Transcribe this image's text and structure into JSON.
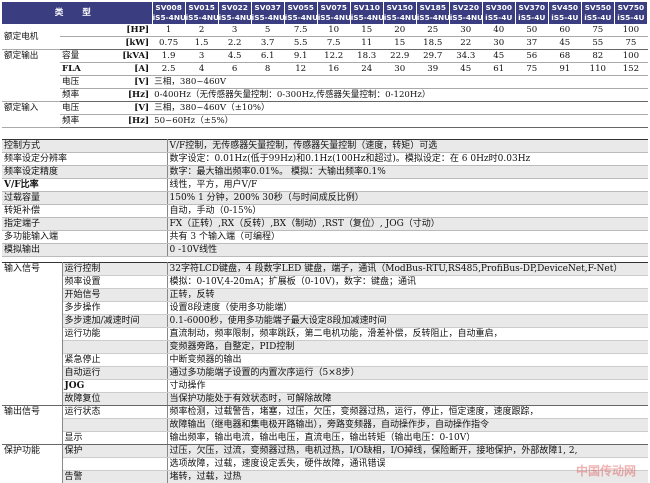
{
  "header": {
    "type_label": "类 型",
    "models": [
      [
        "SV008",
        "iS5-4NU"
      ],
      [
        "SV015",
        "iS5-4NU"
      ],
      [
        "SV022",
        "iS5-4NU"
      ],
      [
        "SV037",
        "iS5-4NU"
      ],
      [
        "SV055",
        "iS5-4NU"
      ],
      [
        "SV075",
        "iS5-4NU"
      ],
      [
        "SV110",
        "iS5-4NU"
      ],
      [
        "SV150",
        "iS5-4NU"
      ],
      [
        "SV185",
        "iS5-4NU"
      ],
      [
        "SV220",
        "iS5-4NU"
      ],
      [
        "SV300",
        "iS5-4U"
      ],
      [
        "SV370",
        "iS5-4U"
      ],
      [
        "SV450",
        "iS5-4U"
      ],
      [
        "SV550",
        "iS5-4U"
      ],
      [
        "SV750",
        "iS5-4U"
      ]
    ]
  },
  "ratings": {
    "motor_label": "额定电机",
    "output_label": "额定输出",
    "input_label": "额定输入",
    "hp": {
      "unit": "[HP]",
      "values": [
        "1",
        "2",
        "3",
        "5",
        "7.5",
        "10",
        "15",
        "20",
        "25",
        "30",
        "40",
        "50",
        "60",
        "75",
        "100"
      ]
    },
    "kw": {
      "unit": "[kW]",
      "values": [
        "0.75",
        "1.5",
        "2.2",
        "3.7",
        "5.5",
        "7.5",
        "11",
        "15",
        "18.5",
        "22",
        "30",
        "37",
        "45",
        "55",
        "75"
      ]
    },
    "kva": {
      "label": "容量",
      "unit": "[kVA]",
      "values": [
        "1.9",
        "3",
        "4.5",
        "6.1",
        "9.1",
        "12.2",
        "18.3",
        "22.9",
        "29.7",
        "34.3",
        "45",
        "56",
        "68",
        "82",
        "100"
      ]
    },
    "fla": {
      "label": "FLA",
      "unit": "[A]",
      "values": [
        "2.5",
        "4",
        "6",
        "8",
        "12",
        "16",
        "24",
        "30",
        "39",
        "45",
        "61",
        "75",
        "91",
        "110",
        "152"
      ]
    },
    "out_voltage": {
      "label": "电压",
      "unit": "[V]",
      "text": "三相，380~460V"
    },
    "out_freq": {
      "label": "频率",
      "unit": "[Hz]",
      "text": "0-400Hz（无传感器矢量控制：0-300Hz,传感器矢量控制：0-120Hz）"
    },
    "in_voltage": {
      "label": "电压",
      "unit": "[V]",
      "text": "三相，380~460V（±10%）"
    },
    "in_freq": {
      "label": "频率",
      "unit": "[Hz]",
      "text": "50~60Hz（±5%）"
    }
  },
  "control": [
    {
      "label": "控制方式",
      "value": "V/F控制，无传感器矢量控制，传感器矢量控制（速度，转矩）可选"
    },
    {
      "label": "频率设定分辨率",
      "value": "数字设定：0.01Hz(低于99Hz)和0.1Hz(100Hz和超过)。模拟设定：在 6 0Hz时0.03Hz"
    },
    {
      "label": "频率设定精度",
      "value": "数字：最大输出频率0.01%。 模拟：大输出频率0.1%"
    },
    {
      "label": "V/F比率",
      "value": "线性，平方，用户V/F"
    },
    {
      "label": "过载容量",
      "value": "150% 1 分钟，200% 30秒（与时间成反比例）"
    },
    {
      "label": "转矩补偿",
      "value": "自动，手动（0-15%）"
    },
    {
      "label": "指定端子",
      "value": "FX（正转）,RX（反转）,BX（制动）,RST（复位）, JOG（寸动）"
    },
    {
      "label": "多功能输入端",
      "value": "共有 3 个输入端（可编程）"
    },
    {
      "label": "模拟输出",
      "value": "0 -10V线性"
    }
  ],
  "io": {
    "input_signal": "输入信号",
    "output_signal": "输出信号",
    "protection": "保护功能",
    "rows": [
      {
        "label": "运行控制",
        "value": "32字符LCD键盘，4 段数字LED 键盘，端子，通讯（ModBus-RTU,RS485,ProfiBus-DP,DeviceNet,F-Net）"
      },
      {
        "label": "频率设置",
        "value": "模拟：0-10V,4-20mA；扩展板（0-10V)，数字：键盘；通讯"
      },
      {
        "label": "开始信号",
        "value": "正转，反转"
      },
      {
        "label": "多步操作",
        "value": "设置8段速度（使用多功能端）"
      },
      {
        "label": "多步速加/减速时间",
        "value": "0.1-6000秒，使用多功能端子最大设定8段加减速时间"
      },
      {
        "label": "运行功能",
        "value": "直流制动，频率限制，频率跳跃，第二电机功能，滑差补偿，反转阻止，自动重启，"
      },
      {
        "label": "",
        "value": "变频器旁路，自整定，PID控制"
      },
      {
        "label": "紧急停止",
        "value": "中断变频器的输出"
      },
      {
        "label": "自动运行",
        "value": "通过多功能端子设置的内置次序运行（5×8步）"
      },
      {
        "label": "JOG",
        "value": "寸动操作"
      },
      {
        "label": "故障复位",
        "value": "当保护功能处于有效状态时，可解除故障"
      },
      {
        "label": "运行状态",
        "value": "频率检测，过载警告，堵塞，过压，欠压，变频器过热，运行，停止，恒定速度，速度跟踪，"
      },
      {
        "label": "",
        "value": "故障输出（继电器和集电极开路输出），旁路变频器，自动操作步，自动操作指令"
      },
      {
        "label": "显示",
        "value": "输出频率，输出电流，输出电压，直流电压，输出转矩（输出电压：0-10V）"
      },
      {
        "label": "保护",
        "value": "过压，欠压，过流，变频器过热，电机过热，I/O缺相，I/O掉线，保险断开，接地保护，外部故障1, 2,"
      },
      {
        "label": "",
        "value": "选项故障，过载，速度设定丢失，硬件故障，通讯错误"
      },
      {
        "label": "告警",
        "value": "堵转，过载，过热"
      }
    ]
  },
  "watermark": "中国传动网"
}
